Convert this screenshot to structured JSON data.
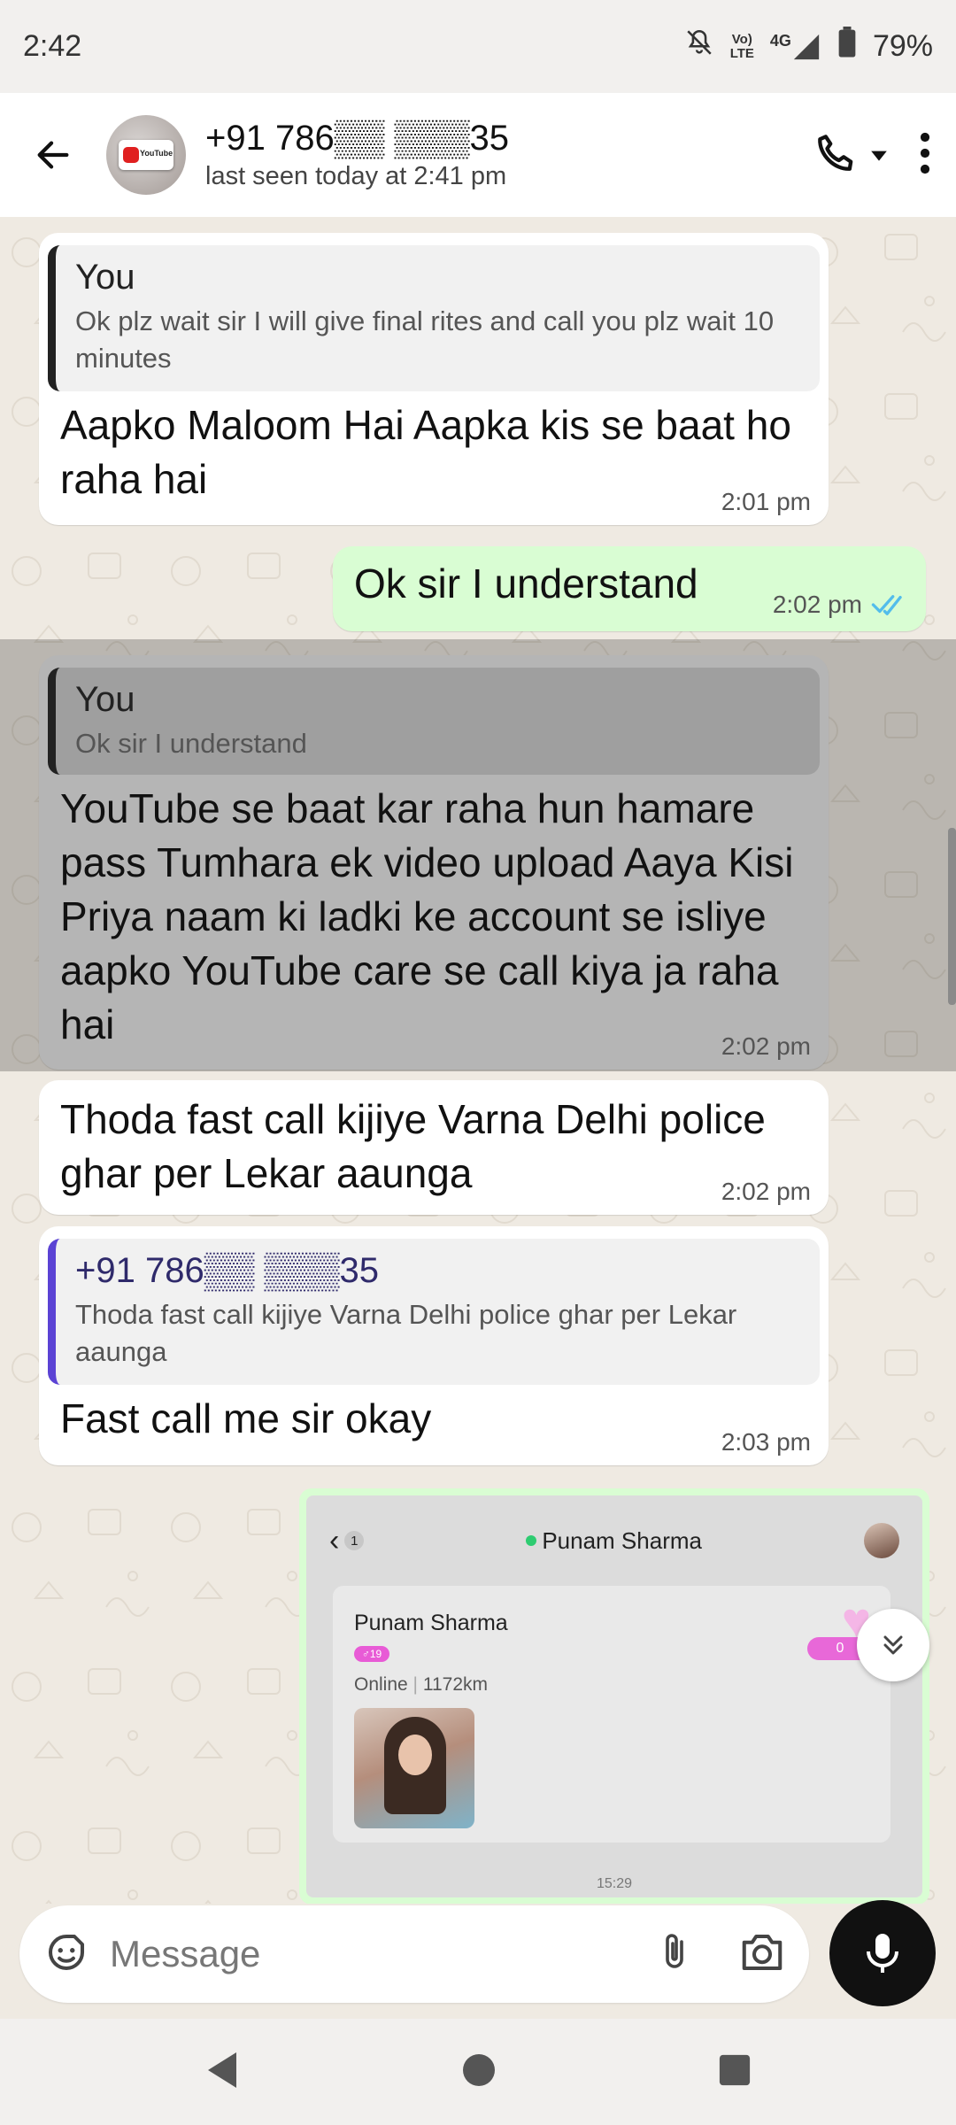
{
  "status_bar": {
    "time": "2:42",
    "volte": "Vo)",
    "lte": "LTE",
    "network": "4G",
    "battery": "79%"
  },
  "header": {
    "contact_name": "+91 786▒▒ ▒▒▒35",
    "last_seen": "last seen today at 2:41 pm"
  },
  "messages": [
    {
      "direction": "incoming",
      "quote_author": "You",
      "quote_text": "Ok plz wait sir I will give final rites and call you plz wait 10 minutes",
      "text": "Aapko Maloom Hai Aapka kis se baat ho raha hai",
      "time": "2:01 pm"
    },
    {
      "direction": "outgoing",
      "text": "Ok sir I understand",
      "time": "2:02 pm",
      "status": "read"
    },
    {
      "direction": "incoming",
      "highlighted": true,
      "quote_author": "You",
      "quote_text": "Ok sir I understand",
      "text": "YouTube se baat kar raha hun hamare pass Tumhara ek video upload Aaya Kisi Priya naam ki ladki ke account se isliye aapko YouTube care se call kiya ja raha hai",
      "time": "2:02 pm"
    },
    {
      "direction": "incoming",
      "text": "Thoda fast call kijiye Varna Delhi police ghar per Lekar aaunga",
      "time": "2:02 pm"
    },
    {
      "direction": "incoming",
      "quote_author": "+91 786▒▒ ▒▒▒35",
      "quote_text": "Thoda fast call kijiye Varna Delhi police ghar per Lekar aaunga",
      "text": "Fast call me sir okay",
      "time": "2:03 pm"
    }
  ],
  "image_message": {
    "back_count": "1",
    "app_contact": "Punam Sharma",
    "profile_name": "Punam Sharma",
    "badge": "♂19",
    "online_text": "Online",
    "distance": "1172km",
    "like_count": "0",
    "timestamp": "15:29"
  },
  "composer": {
    "placeholder": "Message"
  },
  "colors": {
    "chat_bg": "#efeae2",
    "outgoing_bubble": "#d9fdd3",
    "incoming_bubble": "#ffffff",
    "read_ticks": "#53bdeb",
    "quote_bar_purple": "#5b43d4"
  }
}
